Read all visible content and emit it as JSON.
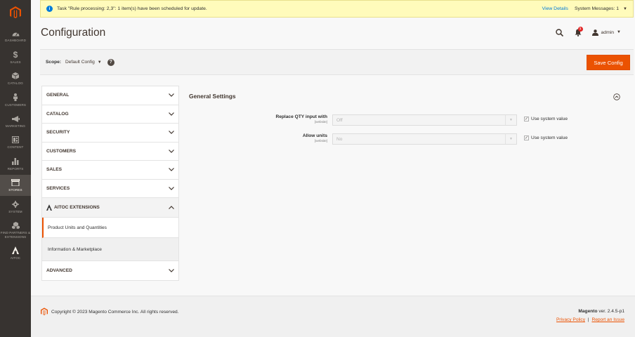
{
  "sidebar": {
    "items": [
      {
        "label": "Dashboard",
        "icon": "dashboard-icon"
      },
      {
        "label": "Sales",
        "icon": "dollar-icon"
      },
      {
        "label": "Catalog",
        "icon": "cube-icon"
      },
      {
        "label": "Customers",
        "icon": "person-icon"
      },
      {
        "label": "Marketing",
        "icon": "megaphone-icon"
      },
      {
        "label": "Content",
        "icon": "content-icon"
      },
      {
        "label": "Reports",
        "icon": "bar-chart-icon"
      },
      {
        "label": "Stores",
        "icon": "store-icon"
      },
      {
        "label": "System",
        "icon": "gear-icon"
      },
      {
        "label": "Find Partners & Extensions",
        "icon": "cubes-icon"
      },
      {
        "label": "Aitoc",
        "icon": "aitoc-icon"
      }
    ]
  },
  "message": {
    "text": "Task \"Rule processing: 2,3\": 1 item(s) have been scheduled for update.",
    "view_details": "View Details",
    "system_messages": "System Messages: 1"
  },
  "header": {
    "title": "Configuration",
    "notification_count": "1",
    "user": "admin"
  },
  "scope": {
    "label": "Scope:",
    "value": "Default Config",
    "help": "?",
    "save_label": "Save Config"
  },
  "tabs": {
    "general": "GENERAL",
    "catalog": "CATALOG",
    "security": "SECURITY",
    "customers": "CUSTOMERS",
    "sales": "SALES",
    "services": "SERVICES",
    "aitoc": "AITOC EXTENSIONS",
    "aitoc_sub": [
      "Product Units and Quantities",
      "Information & Marketplace"
    ],
    "advanced": "ADVANCED"
  },
  "content": {
    "section_title": "General Settings",
    "fields": [
      {
        "label": "Replace QTY input with",
        "scope": "[website]",
        "value": "Off",
        "checkbox_label": "Use system value",
        "checked": true
      },
      {
        "label": "Allow units",
        "scope": "[website]",
        "value": "No",
        "checkbox_label": "Use system value",
        "checked": true
      }
    ]
  },
  "footer": {
    "copyright": "Copyright © 2023 Magento Commerce Inc. All rights reserved.",
    "product": "Magento",
    "version": "ver. 2.4.5-p1",
    "privacy": "Privacy Policy",
    "separator": "|",
    "report": "Report an Issue"
  },
  "colors": {
    "accent": "#eb5202",
    "sidebar_bg": "#373330",
    "message_bg": "#fffbbb"
  }
}
